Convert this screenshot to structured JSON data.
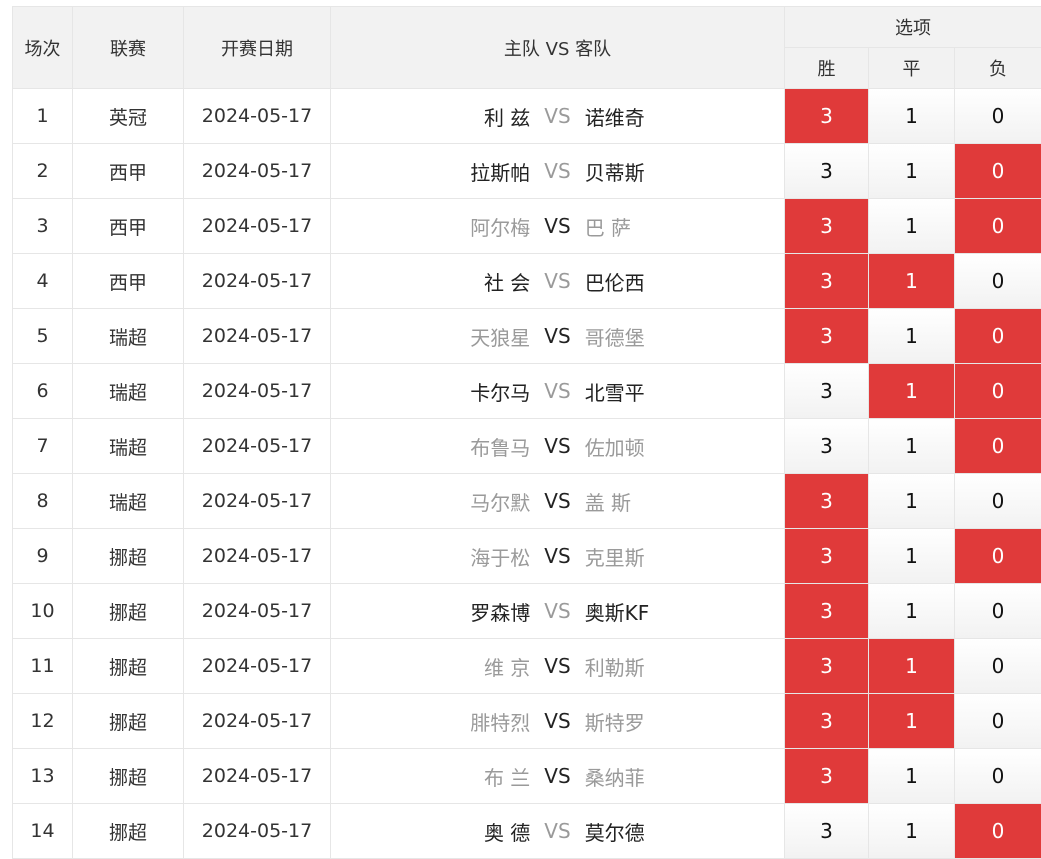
{
  "headers": {
    "match_no": "场次",
    "league": "联赛",
    "date": "开赛日期",
    "teams": "主队  VS  客队",
    "options": "选项",
    "win": "胜",
    "draw": "平",
    "lose": "负"
  },
  "colors": {
    "selected": "#e03a3a",
    "muted_text": "#9a9a9a",
    "header_bg": "#f2f2f2",
    "border": "#e6e6e6"
  },
  "rows": [
    {
      "no": "1",
      "league": "英冠",
      "date": "2024-05-17",
      "home": "利 兹",
      "away": "诺维奇",
      "vs": "VS",
      "home_muted": false,
      "away_muted": false,
      "vs_dark": false,
      "win": "3",
      "draw": "1",
      "lose": "0",
      "sel": [
        true,
        false,
        false
      ]
    },
    {
      "no": "2",
      "league": "西甲",
      "date": "2024-05-17",
      "home": "拉斯帕",
      "away": "贝蒂斯",
      "vs": "VS",
      "home_muted": false,
      "away_muted": false,
      "vs_dark": false,
      "win": "3",
      "draw": "1",
      "lose": "0",
      "sel": [
        false,
        false,
        true
      ]
    },
    {
      "no": "3",
      "league": "西甲",
      "date": "2024-05-17",
      "home": "阿尔梅",
      "away": "巴 萨",
      "vs": "VS",
      "home_muted": true,
      "away_muted": true,
      "vs_dark": true,
      "win": "3",
      "draw": "1",
      "lose": "0",
      "sel": [
        true,
        false,
        true
      ]
    },
    {
      "no": "4",
      "league": "西甲",
      "date": "2024-05-17",
      "home": "社 会",
      "away": "巴伦西",
      "vs": "VS",
      "home_muted": false,
      "away_muted": false,
      "vs_dark": false,
      "win": "3",
      "draw": "1",
      "lose": "0",
      "sel": [
        true,
        true,
        false
      ]
    },
    {
      "no": "5",
      "league": "瑞超",
      "date": "2024-05-17",
      "home": "天狼星",
      "away": "哥德堡",
      "vs": "VS",
      "home_muted": true,
      "away_muted": true,
      "vs_dark": true,
      "win": "3",
      "draw": "1",
      "lose": "0",
      "sel": [
        true,
        false,
        true
      ]
    },
    {
      "no": "6",
      "league": "瑞超",
      "date": "2024-05-17",
      "home": "卡尔马",
      "away": "北雪平",
      "vs": "VS",
      "home_muted": false,
      "away_muted": false,
      "vs_dark": false,
      "win": "3",
      "draw": "1",
      "lose": "0",
      "sel": [
        false,
        true,
        true
      ]
    },
    {
      "no": "7",
      "league": "瑞超",
      "date": "2024-05-17",
      "home": "布鲁马",
      "away": "佐加顿",
      "vs": "VS",
      "home_muted": true,
      "away_muted": true,
      "vs_dark": true,
      "win": "3",
      "draw": "1",
      "lose": "0",
      "sel": [
        false,
        false,
        true
      ]
    },
    {
      "no": "8",
      "league": "瑞超",
      "date": "2024-05-17",
      "home": "马尔默",
      "away": "盖 斯",
      "vs": "VS",
      "home_muted": true,
      "away_muted": true,
      "vs_dark": true,
      "win": "3",
      "draw": "1",
      "lose": "0",
      "sel": [
        true,
        false,
        false
      ]
    },
    {
      "no": "9",
      "league": "挪超",
      "date": "2024-05-17",
      "home": "海于松",
      "away": "克里斯",
      "vs": "VS",
      "home_muted": true,
      "away_muted": true,
      "vs_dark": true,
      "win": "3",
      "draw": "1",
      "lose": "0",
      "sel": [
        true,
        false,
        true
      ]
    },
    {
      "no": "10",
      "league": "挪超",
      "date": "2024-05-17",
      "home": "罗森博",
      "away": "奥斯KF",
      "vs": "VS",
      "home_muted": false,
      "away_muted": false,
      "vs_dark": false,
      "win": "3",
      "draw": "1",
      "lose": "0",
      "sel": [
        true,
        false,
        false
      ]
    },
    {
      "no": "11",
      "league": "挪超",
      "date": "2024-05-17",
      "home": "维 京",
      "away": "利勒斯",
      "vs": "VS",
      "home_muted": true,
      "away_muted": true,
      "vs_dark": true,
      "win": "3",
      "draw": "1",
      "lose": "0",
      "sel": [
        true,
        true,
        false
      ]
    },
    {
      "no": "12",
      "league": "挪超",
      "date": "2024-05-17",
      "home": "腓特烈",
      "away": "斯特罗",
      "vs": "VS",
      "home_muted": true,
      "away_muted": true,
      "vs_dark": true,
      "win": "3",
      "draw": "1",
      "lose": "0",
      "sel": [
        true,
        true,
        false
      ]
    },
    {
      "no": "13",
      "league": "挪超",
      "date": "2024-05-17",
      "home": "布 兰",
      "away": "桑纳菲",
      "vs": "VS",
      "home_muted": true,
      "away_muted": true,
      "vs_dark": true,
      "win": "3",
      "draw": "1",
      "lose": "0",
      "sel": [
        true,
        false,
        false
      ]
    },
    {
      "no": "14",
      "league": "挪超",
      "date": "2024-05-17",
      "home": "奥 德",
      "away": "莫尔德",
      "vs": "VS",
      "home_muted": false,
      "away_muted": false,
      "vs_dark": false,
      "win": "3",
      "draw": "1",
      "lose": "0",
      "sel": [
        false,
        false,
        true
      ]
    }
  ]
}
